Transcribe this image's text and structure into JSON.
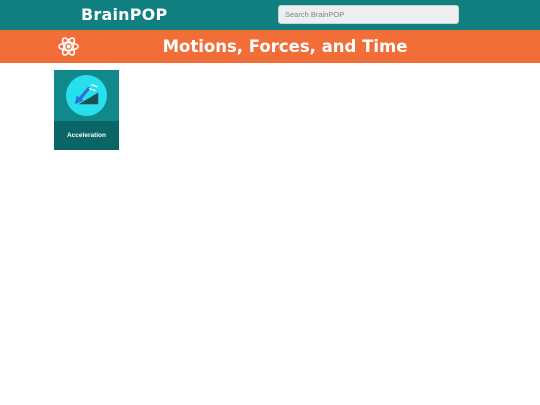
{
  "header": {
    "logo_text": "BrainPOP",
    "search": {
      "placeholder": "Search BrainPOP",
      "value": ""
    },
    "bar_color": "#0f7f80"
  },
  "banner": {
    "icon": "atom-icon",
    "title": "Motions, Forces, and Time",
    "color": "#f26e39"
  },
  "topics": [
    {
      "label": "Acceleration",
      "icon": "acceleration-icon",
      "tile_color": "#118889",
      "label_bar_color": "#0a6566"
    }
  ]
}
